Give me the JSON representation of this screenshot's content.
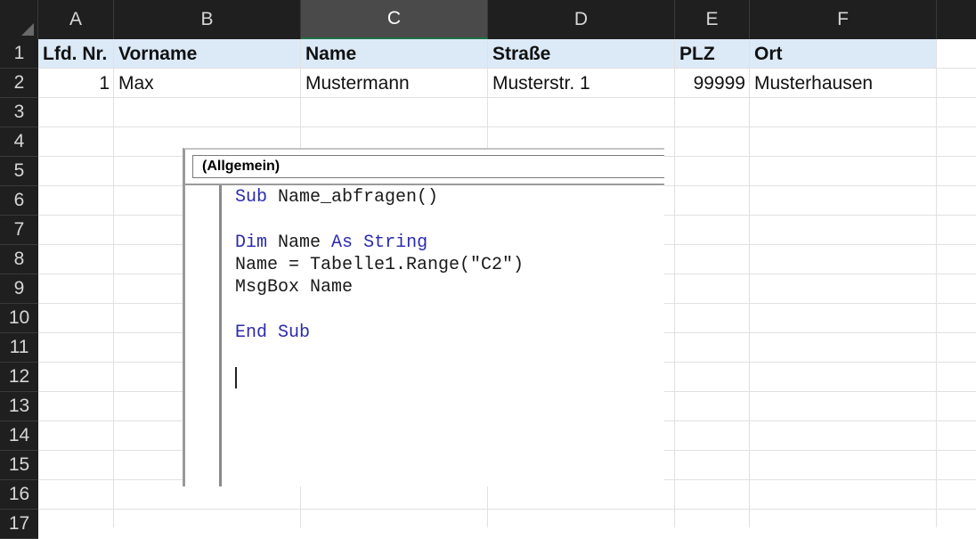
{
  "columns": [
    "A",
    "B",
    "C",
    "D",
    "E",
    "F"
  ],
  "selected_column": "C",
  "rows": [
    "1",
    "2",
    "3",
    "4",
    "5",
    "6",
    "7",
    "8",
    "9",
    "10",
    "11",
    "12",
    "13",
    "14",
    "15",
    "16",
    "17"
  ],
  "table": {
    "headers": [
      "Lfd. Nr.",
      "Vorname",
      "Name",
      "Straße",
      "PLZ",
      "Ort"
    ],
    "records": [
      [
        "1",
        "Max",
        "Mustermann",
        "Musterstr. 1",
        "99999",
        "Musterhausen"
      ]
    ]
  },
  "vba_editor": {
    "object_dropdown": "(Allgemein)",
    "code": {
      "line1_kw": "Sub",
      "line1_rest": " Name_abfragen()",
      "line2_kw1": "Dim",
      "line2_mid": " Name ",
      "line2_kw2": "As",
      "line2_sp": " ",
      "line2_kw3": "String",
      "line3": "Name = Tabelle1.Range(\"C2\")",
      "line4": "MsgBox Name",
      "line5_kw": "End Sub"
    }
  },
  "colors": {
    "header_bg": "#1f1f1f",
    "selected_col_bg": "#4a4a4a",
    "header_row_fill": "#dce9f7",
    "keyword": "#2b2bb0"
  }
}
